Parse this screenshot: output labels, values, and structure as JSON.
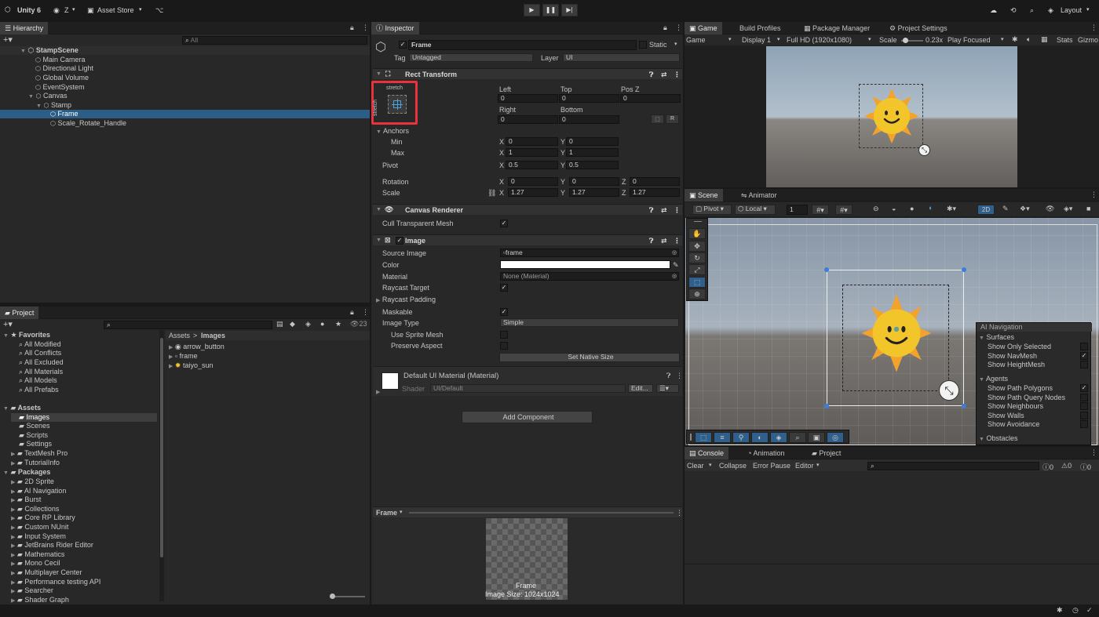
{
  "topbar": {
    "app": "Unity 6",
    "account": "Z",
    "asset_store": "Asset Store",
    "layout": "Layout"
  },
  "hierarchy": {
    "tab": "Hierarchy",
    "search_placeholder": "All",
    "scene": "StampScene",
    "items": [
      "Main Camera",
      "Directional Light",
      "Global Volume",
      "EventSystem",
      "Canvas",
      "Stamp",
      "Frame",
      "Scale_Rotate_Handle"
    ]
  },
  "project": {
    "tab": "Project",
    "count": "23",
    "favorites_label": "Favorites",
    "favorites": [
      "All Modified",
      "All Conflicts",
      "All Excluded",
      "All Materials",
      "All Models",
      "All Prefabs"
    ],
    "assets_label": "Assets",
    "assets": [
      "Images",
      "Scenes",
      "Scripts",
      "Settings",
      "TextMesh Pro",
      "TutorialInfo"
    ],
    "packages_label": "Packages",
    "packages": [
      "2D Sprite",
      "AI Navigation",
      "Burst",
      "Collections",
      "Core RP Library",
      "Custom NUnit",
      "Input System",
      "JetBrains Rider Editor",
      "Mathematics",
      "Mono Cecil",
      "Multiplayer Center",
      "Performance testing API",
      "Searcher",
      "Shader Graph"
    ],
    "breadcrumb_root": "Assets",
    "breadcrumb_sep": ">",
    "breadcrumb_leaf": "Images",
    "files": [
      "arrow_button",
      "frame",
      "taiyo_sun"
    ]
  },
  "inspector": {
    "tab": "Inspector",
    "name": "Frame",
    "static_label": "Static",
    "tag_label": "Tag",
    "tag": "Untagged",
    "layer_label": "Layer",
    "layer": "UI",
    "rect": {
      "title": "Rect Transform",
      "stretch_top": "stretch",
      "stretch_side": "stretch",
      "left_label": "Left",
      "top_label": "Top",
      "posz_label": "Pos Z",
      "left": "0",
      "top": "0",
      "posz": "0",
      "right_label": "Right",
      "bottom_label": "Bottom",
      "right": "0",
      "bottom": "0",
      "r_btn": "R",
      "anchors": "Anchors",
      "min": "Min",
      "max": "Max",
      "min_x": "0",
      "min_y": "0",
      "max_x": "1",
      "max_y": "1",
      "pivot": "Pivot",
      "pivot_x": "0.5",
      "pivot_y": "0.5",
      "rotation": "Rotation",
      "rot_x": "0",
      "rot_y": "0",
      "rot_z": "0",
      "scale": "Scale",
      "scale_x": "1.27",
      "scale_y": "1.27",
      "scale_z": "1.27",
      "x": "X",
      "y": "Y",
      "z": "Z"
    },
    "canvas_renderer": {
      "title": "Canvas Renderer",
      "cull": "Cull Transparent Mesh"
    },
    "image": {
      "title": "Image",
      "source_label": "Source Image",
      "source": "frame",
      "color_label": "Color",
      "material_label": "Material",
      "material": "None (Material)",
      "raycast_target": "Raycast Target",
      "raycast_padding": "Raycast Padding",
      "maskable": "Maskable",
      "image_type_label": "Image Type",
      "image_type": "Simple",
      "use_sprite_mesh": "Use Sprite Mesh",
      "preserve_aspect": "Preserve Aspect",
      "set_native": "Set Native Size"
    },
    "material": {
      "title": "Default UI Material (Material)",
      "shader_label": "Shader",
      "shader": "UI/Default",
      "edit": "Edit..."
    },
    "add_component": "Add Component",
    "preview": {
      "label": "Frame",
      "name": "Frame",
      "size": "Image Size: 1024x1024"
    }
  },
  "game": {
    "tabs": [
      "Game",
      "Build Profiles",
      "Package Manager",
      "Project Settings"
    ],
    "mode": "Game",
    "display": "Display 1",
    "resolution": "Full HD (1920x1080)",
    "scale_label": "Scale",
    "scale": "0.23x",
    "play": "Play Focused",
    "stats": "Stats",
    "gizmos": "Gizmo"
  },
  "scene": {
    "tabs": [
      "Scene",
      "Animator"
    ],
    "pivot": "Pivot",
    "local": "Local",
    "grid": "1",
    "mode2d": "2D"
  },
  "ai_nav": {
    "title": "AI Navigation",
    "surfaces": "Surfaces",
    "surface_items": [
      "Show Only Selected",
      "Show NavMesh",
      "Show HeightMesh"
    ],
    "agents": "Agents",
    "agent_items": [
      "Show Path Polygons",
      "Show Path Query Nodes",
      "Show Neighbours",
      "Show Walls",
      "Show Avoidance"
    ],
    "obstacles": "Obstacles"
  },
  "console": {
    "tabs": [
      "Console",
      "Animation",
      "Project"
    ],
    "clear": "Clear",
    "collapse": "Collapse",
    "error_pause": "Error Pause",
    "editor": "Editor",
    "c0": "0",
    "c1": "0",
    "c2": "0"
  },
  "colors": {
    "selection": "#2c5d87",
    "highlight_box": "#e8333c",
    "sun": "#f2c52a",
    "sky": "#a9b8c6"
  }
}
